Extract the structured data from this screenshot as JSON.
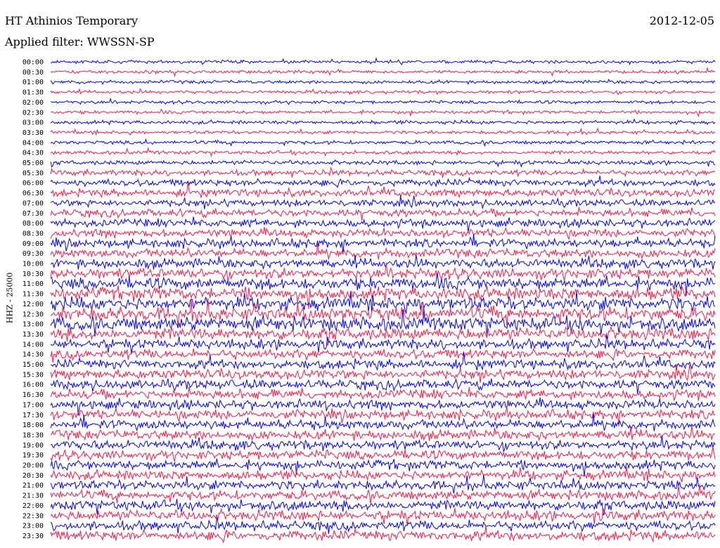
{
  "header": {
    "title": "HT Athinios Temporary",
    "date": "2012-12-05",
    "filter": "Applied filter: WWSSN-SP"
  },
  "chart_data": {
    "type": "line",
    "title": "HT Athinios Temporary",
    "ylabel": "HHZ - 25000",
    "xlabel": "",
    "row_labels": [
      "00:00",
      "00:30",
      "01:00",
      "01:30",
      "02:00",
      "02:30",
      "03:00",
      "03:30",
      "04:00",
      "04:30",
      "05:00",
      "05:30",
      "06:00",
      "06:30",
      "07:00",
      "07:30",
      "08:00",
      "08:30",
      "09:00",
      "09:30",
      "10:00",
      "10:30",
      "11:00",
      "11:30",
      "12:00",
      "12:30",
      "13:00",
      "13:30",
      "14:00",
      "14:30",
      "15:00",
      "15:30",
      "16:00",
      "16:30",
      "17:00",
      "17:30",
      "18:00",
      "18:30",
      "19:00",
      "19:30",
      "20:00",
      "20:30",
      "21:00",
      "21:30",
      "22:00",
      "22:30",
      "23:00",
      "23:30"
    ],
    "series_colors": [
      "#0000ff",
      "#ff1744"
    ],
    "row_activity": [
      0.12,
      0.12,
      0.12,
      0.12,
      0.12,
      0.12,
      0.15,
      0.12,
      0.15,
      0.15,
      0.2,
      0.3,
      0.4,
      0.45,
      0.4,
      0.45,
      0.5,
      0.5,
      0.55,
      0.55,
      0.6,
      0.7,
      0.8,
      0.85,
      0.9,
      0.95,
      0.95,
      0.8,
      0.65,
      0.6,
      0.6,
      0.6,
      0.6,
      0.6,
      0.6,
      0.6,
      0.6,
      0.6,
      0.6,
      0.6,
      0.6,
      0.6,
      0.6,
      0.6,
      0.65,
      0.65,
      0.6,
      0.65
    ],
    "grid": false,
    "legend": "none"
  }
}
